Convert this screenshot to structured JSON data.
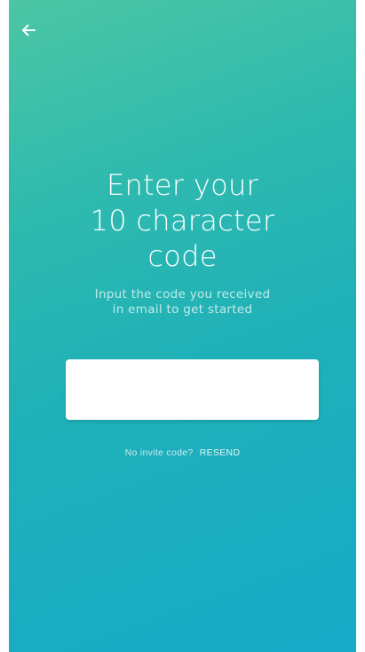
{
  "header": {
    "back_icon": "arrow-left-icon"
  },
  "title": {
    "line1": "Enter your",
    "line2": "10 character",
    "line3": "code"
  },
  "subtitle": {
    "line1": "Input the code you received",
    "line2": "in email to get started"
  },
  "code_input": {
    "value": "",
    "placeholder": ""
  },
  "footer": {
    "no_invite_label": "No invite code?",
    "resend_label": "RESEND"
  },
  "colors": {
    "gradient_top": "#4cc6a4",
    "gradient_bottom": "#17a9c7",
    "text": "#ffffff",
    "input_background": "#ffffff"
  }
}
